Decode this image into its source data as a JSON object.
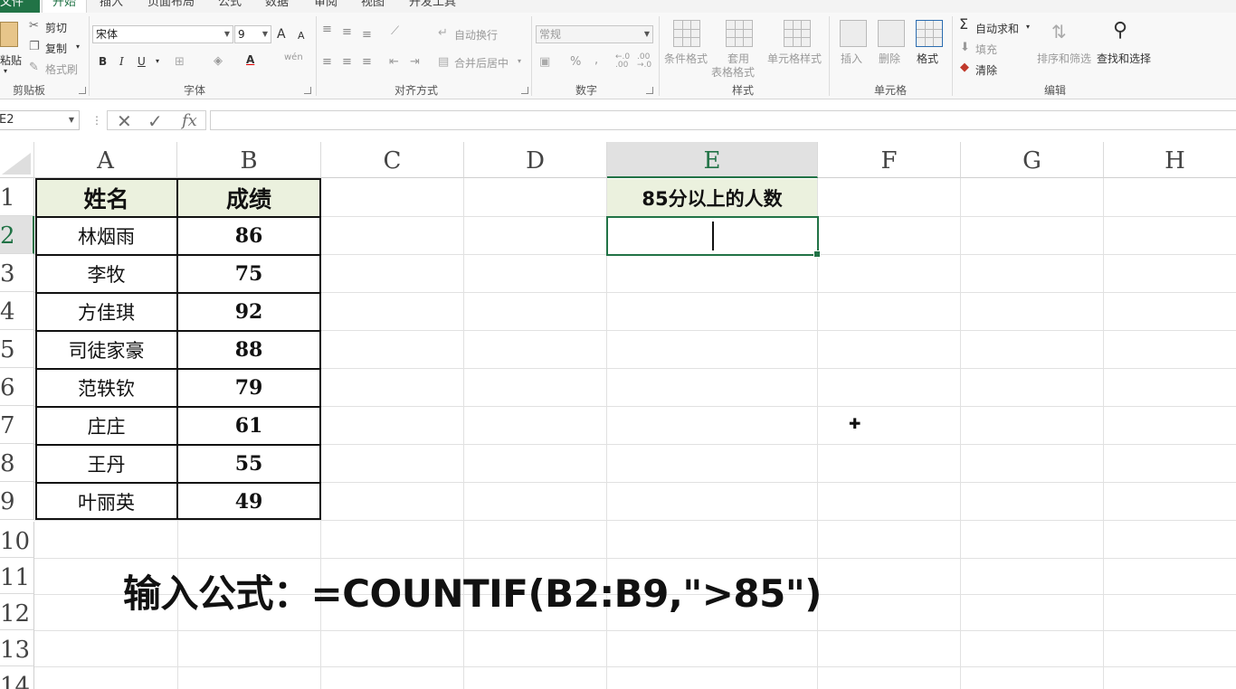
{
  "tabs": [
    "文件",
    "开始",
    "插入",
    "页面布局",
    "公式",
    "数据",
    "审阅",
    "视图",
    "开发工具"
  ],
  "ribbon": {
    "clipboard": {
      "paste": "粘贴",
      "cut": "剪切",
      "copy": "复制",
      "format_painter": "格式刷",
      "label": "剪贴板"
    },
    "font": {
      "font_name": "宋体",
      "font_size": "9",
      "bold": "B",
      "italic": "I",
      "underline": "U",
      "grow": "A",
      "shrink": "A",
      "font_color": "A",
      "phonetic": "wén",
      "label": "字体"
    },
    "alignment": {
      "wrap_text": "自动换行",
      "merge_center": "合并后居中",
      "label": "对齐方式"
    },
    "number": {
      "format": "常规",
      "percent": "%",
      "comma": ",",
      "inc_decimal": "←.0 .00",
      "dec_decimal": ".00 →.0",
      "label": "数字"
    },
    "styles": {
      "conditional": "条件格式",
      "as_table_1": "套用",
      "as_table_2": "表格格式",
      "cell_styles": "单元格样式",
      "label": "样式"
    },
    "cells": {
      "insert": "插入",
      "delete": "删除",
      "format": "格式",
      "label": "单元格"
    },
    "editing": {
      "autosum": "自动求和",
      "fill": "填充",
      "clear": "清除",
      "sort_filter": "排序和筛选",
      "find_select": "查找和选择",
      "label": "编辑"
    }
  },
  "formula_bar": {
    "name_box": "E2",
    "formula": "",
    "fx": "fx"
  },
  "columns": [
    "A",
    "B",
    "C",
    "D",
    "E",
    "F",
    "G",
    "H"
  ],
  "rows": [
    "1",
    "2",
    "3",
    "4",
    "5",
    "6",
    "7",
    "8",
    "9",
    "10",
    "11",
    "12",
    "13",
    "14"
  ],
  "table": {
    "header_name": "姓名",
    "header_score": "成绩",
    "records": [
      {
        "name": "林烟雨",
        "score": "86"
      },
      {
        "name": "李牧",
        "score": "75"
      },
      {
        "name": "方佳琪",
        "score": "92"
      },
      {
        "name": "司徒家豪",
        "score": "88"
      },
      {
        "name": "范轶钦",
        "score": "79"
      },
      {
        "name": "庄庄",
        "score": "61"
      },
      {
        "name": "王丹",
        "score": "55"
      },
      {
        "name": "叶丽英",
        "score": "49"
      }
    ]
  },
  "e1_header": "85分以上的人数",
  "caption": "输入公式：=COUNTIF(B2:B9,\">85\")",
  "colors": {
    "accent": "#217346",
    "header_fill": "#ebf1de"
  }
}
